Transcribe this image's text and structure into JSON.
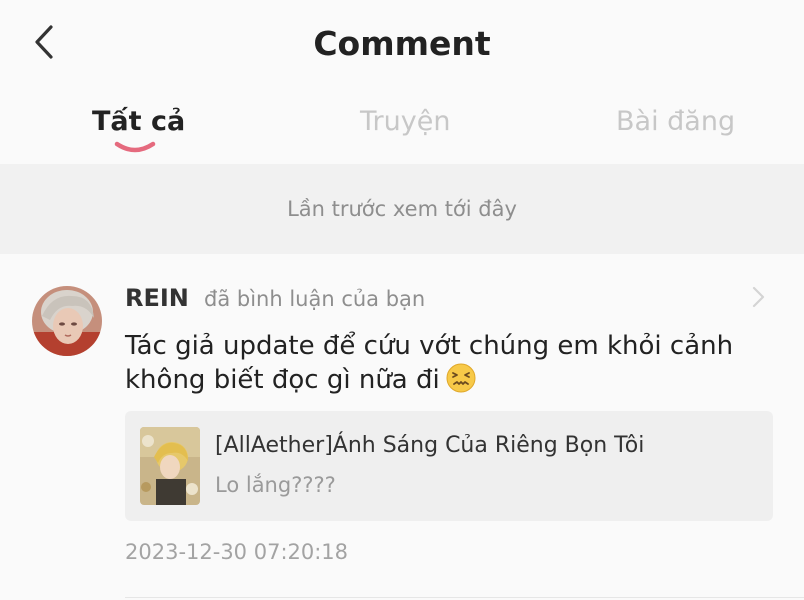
{
  "header": {
    "title": "Comment",
    "back_icon": "chevron-left-icon"
  },
  "tabs": [
    {
      "label": "Tất cả",
      "active": true
    },
    {
      "label": "Truyện",
      "active": false
    },
    {
      "label": "Bài đăng",
      "active": false
    }
  ],
  "colors": {
    "accent": "#e56a7e",
    "inactive_tab": "#c7c7c7",
    "divider_bg": "#f1f1f1",
    "card_bg": "#efefef"
  },
  "divider": {
    "text": "Lần trước xem tới đây"
  },
  "comment": {
    "username": "REIN",
    "action": "đã bình luận của bạn",
    "body": "Tác giả update để cứu vớt chúng em khỏi cảnh không biết đọc gì nữa đi",
    "emoji": "confounded-face-emoji",
    "story": {
      "title": "[AllAether]Ánh Sáng Của Riêng Bọn Tôi",
      "subtitle": "Lo lắng????"
    },
    "timestamp": "2023-12-30 07:20:18"
  }
}
